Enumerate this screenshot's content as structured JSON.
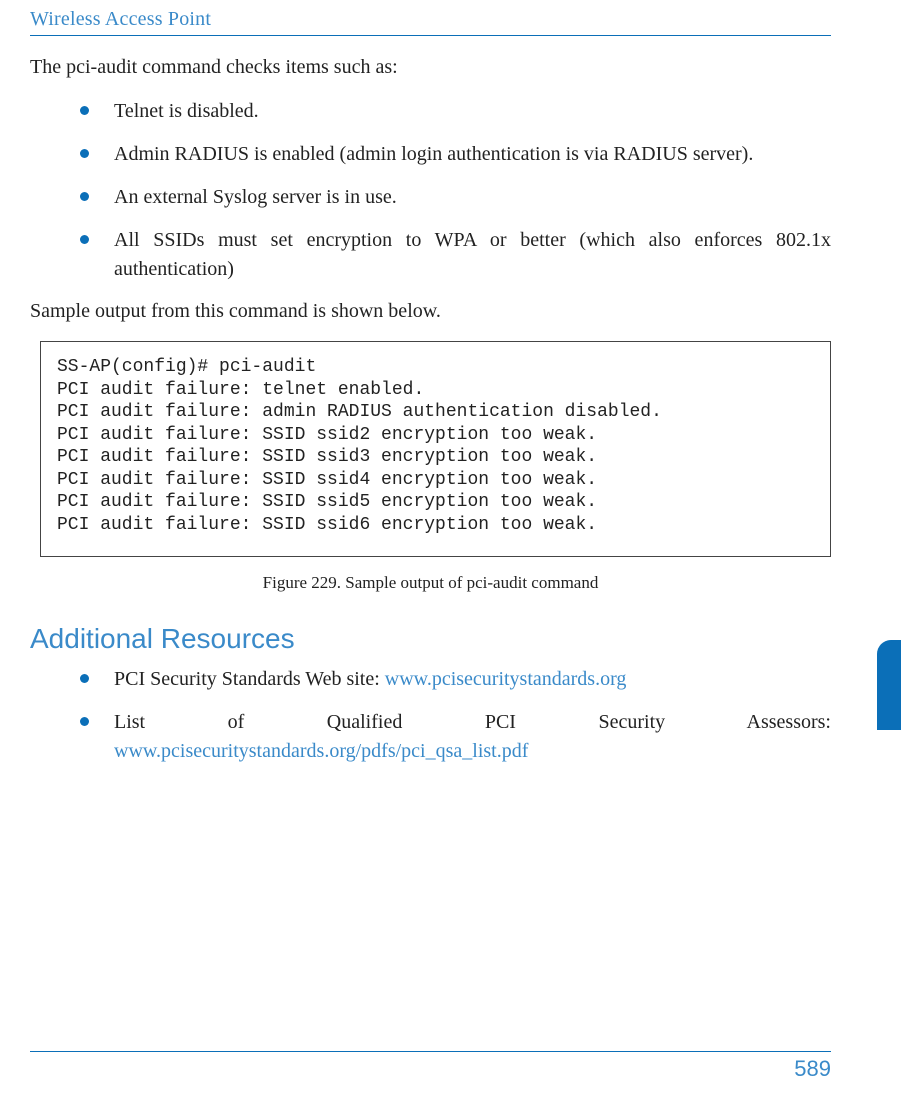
{
  "header": {
    "title": "Wireless Access Point"
  },
  "intro": "The pci-audit command checks items such as:",
  "checks": [
    "Telnet is disabled.",
    "Admin RADIUS is enabled (admin login authentication is via RADIUS server).",
    "An external Syslog server is in use.",
    "All SSIDs must set encryption to WPA or better (which also enforces 802.1x authentication)"
  ],
  "sample_intro": "Sample output from this command is shown below.",
  "code_lines": [
    "SS-AP(config)# pci-audit",
    "PCI audit failure: telnet enabled.",
    "PCI audit failure: admin RADIUS authentication disabled.",
    "PCI audit failure: SSID ssid2 encryption too weak.",
    "PCI audit failure: SSID ssid3 encryption too weak.",
    "PCI audit failure: SSID ssid4 encryption too weak.",
    "PCI audit failure: SSID ssid5 encryption too weak.",
    "PCI audit failure: SSID ssid6 encryption too weak."
  ],
  "figure_caption": "Figure 229. Sample output of pci-audit command",
  "resources": {
    "heading": "Additional Resources",
    "items": [
      {
        "prefix": "PCI Security Standards Web site: ",
        "link": "www.pcisecuritystandards.org"
      },
      {
        "prefix": "List of Qualified PCI Security Assessors: ",
        "link": "www.pcisecuritystandards.org/pdfs/pci_qsa_list.pdf"
      }
    ]
  },
  "page_number": "589"
}
